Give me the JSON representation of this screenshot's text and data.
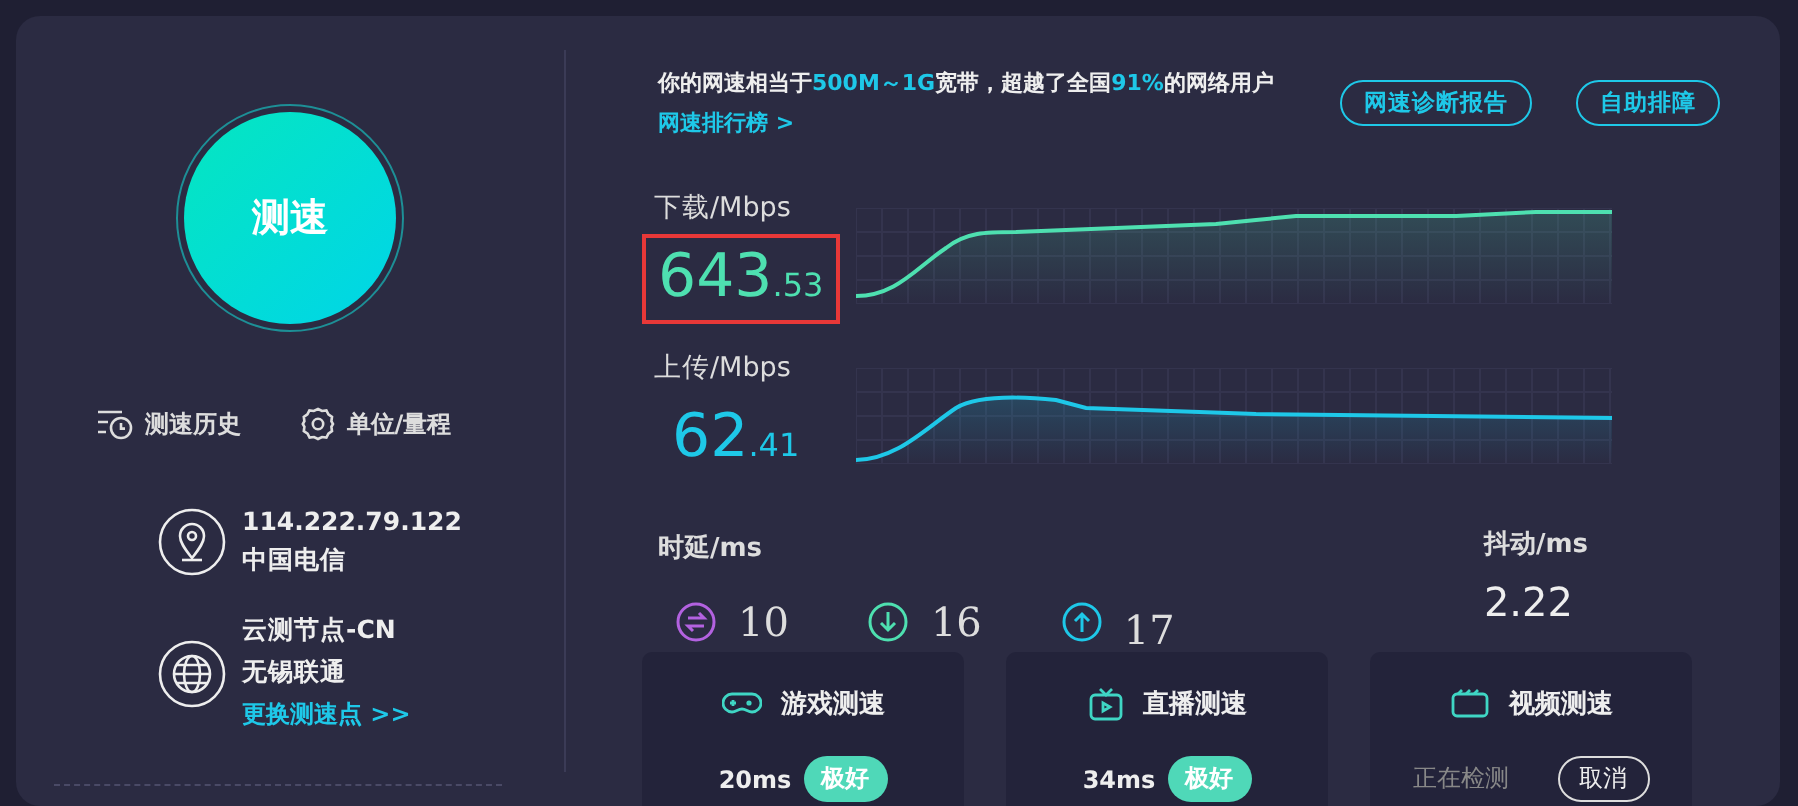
{
  "test_button": {
    "label": "测速"
  },
  "tools": [
    {
      "kind": "history",
      "label": "测速历史"
    },
    {
      "kind": "settings",
      "label": "单位/量程"
    }
  ],
  "connection": [
    {
      "kind": "location",
      "lines": [
        "114.222.79.122",
        "中国电信"
      ]
    },
    {
      "kind": "globe",
      "lines": [
        "云测节点-CN",
        "无锡联通"
      ],
      "link": "更换测速点 >>"
    }
  ],
  "summary": [
    {
      "text": "你的网速相当于",
      "highlight": false
    },
    {
      "text": "500M～1G",
      "highlight": true
    },
    {
      "text": "宽带，超越了全国",
      "highlight": false
    },
    {
      "text": "91%",
      "highlight": true
    },
    {
      "text": "的网络用户",
      "highlight": false
    }
  ],
  "ranking_link": "网速排行榜 >",
  "buttons": [
    "网速诊断报告",
    "自助排障"
  ],
  "speeds": [
    {
      "kind": "download",
      "label": "下载/Mbps",
      "integer": "643",
      "decimal": ".53",
      "highlighted": true
    },
    {
      "kind": "upload",
      "label": "上传/Mbps",
      "integer": "62",
      "decimal": ".41",
      "highlighted": false
    }
  ],
  "latency": {
    "label": "时延/ms",
    "items": [
      {
        "kind": "exchange",
        "value": "10"
      },
      {
        "kind": "down",
        "value": "16"
      },
      {
        "kind": "up",
        "value": "17"
      }
    ]
  },
  "jitter": {
    "label": "抖动/ms",
    "value": "2.22"
  },
  "tests": [
    {
      "kind": "game",
      "title": "游戏测速",
      "result": "20ms",
      "rating": "极好"
    },
    {
      "kind": "live",
      "title": "直播测速",
      "result": "34ms",
      "rating": "极好"
    },
    {
      "kind": "video",
      "title": "视频测速",
      "status": "正在检测",
      "action": "取消"
    }
  ]
}
